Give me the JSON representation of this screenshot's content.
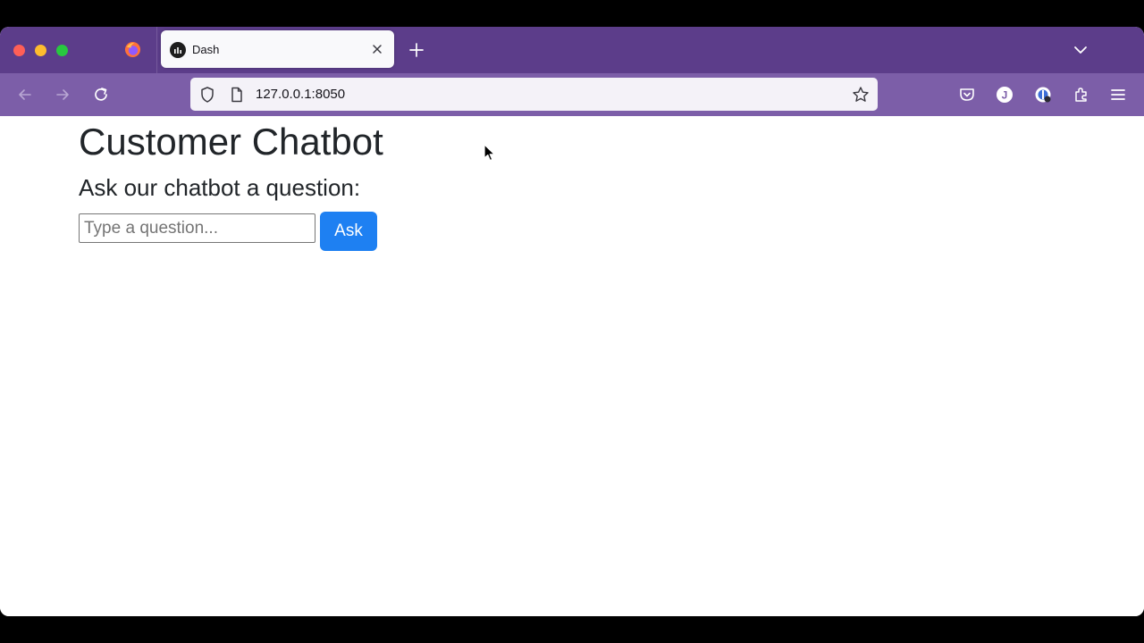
{
  "browser": {
    "tab": {
      "title": "Dash"
    },
    "address_bar": {
      "url": "127.0.0.1:8050"
    },
    "theme": {
      "tabstrip_color": "#5c3d8a",
      "navbar_color": "#7c5ea8"
    },
    "icons": {
      "firefox": "firefox-icon",
      "favicon": "dash-favicon-icon",
      "close": "close-icon",
      "new_tab": "plus-icon",
      "tab_list": "chevron-down-icon",
      "back": "back-arrow-icon",
      "forward": "forward-arrow-icon",
      "reload": "reload-icon",
      "tracking_protection": "shield-icon",
      "page_info": "page-icon",
      "bookmark": "star-icon",
      "pocket": "pocket-icon",
      "account": "account-icon",
      "extension_badge": "extension-badge-icon",
      "extensions": "puzzle-icon",
      "menu": "hamburger-menu-icon"
    },
    "account_initial": "J"
  },
  "page": {
    "title": "Customer Chatbot",
    "subtitle": "Ask our chatbot a question:",
    "question_input": {
      "value": "",
      "placeholder": "Type a question..."
    },
    "ask_button": {
      "label": "Ask",
      "color": "#1e80f2"
    }
  }
}
